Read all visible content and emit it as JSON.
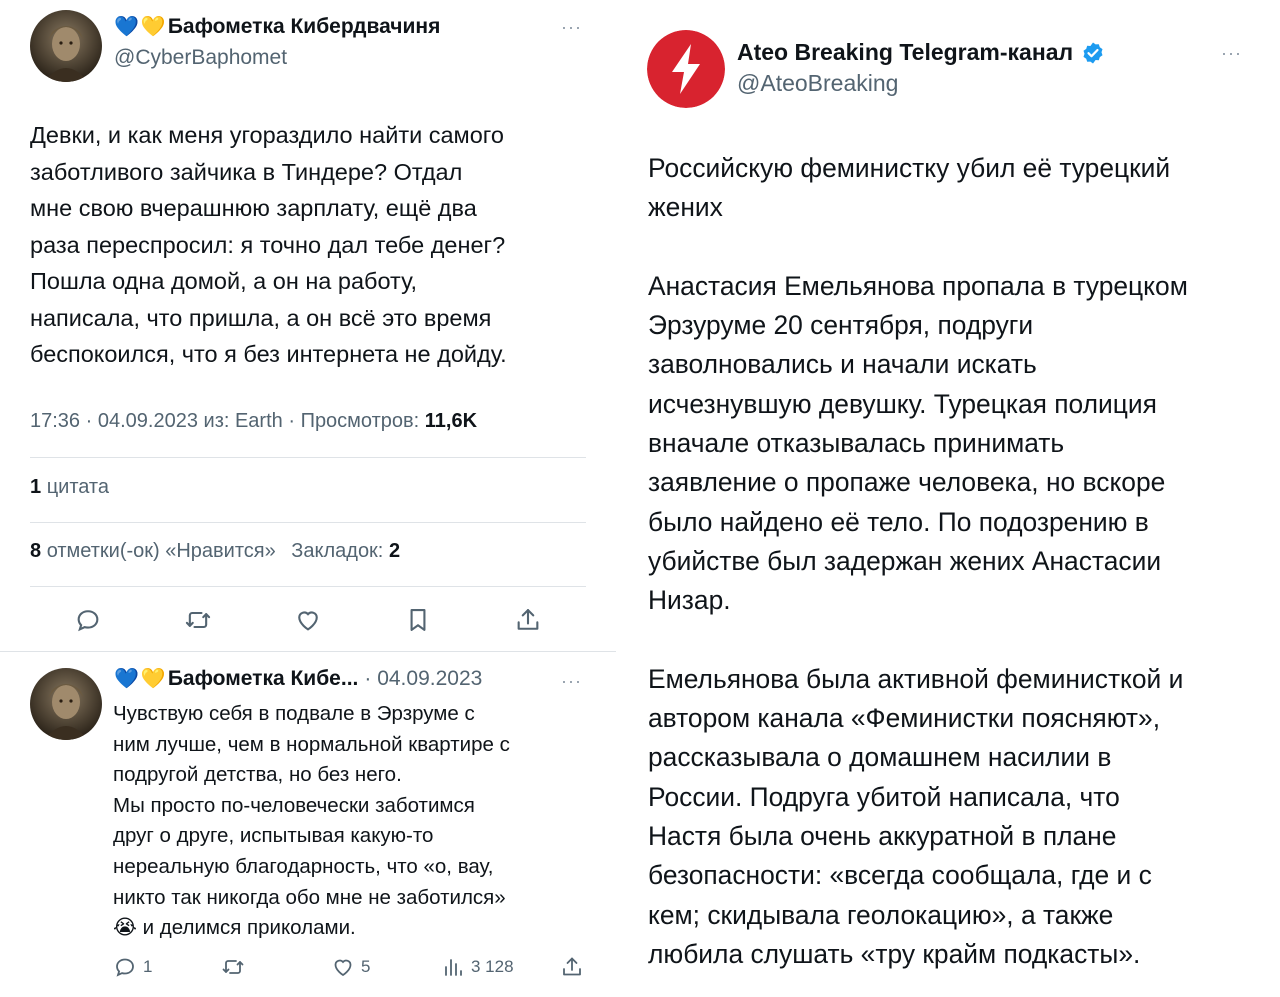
{
  "left_tweet": {
    "author_name": "Бафометка Кибердвачиня",
    "hearts": [
      "💙",
      "💛"
    ],
    "handle": "@CyberBaphomet",
    "more_icon": "more-dots-icon",
    "body": "Девки, и как меня угораздило найти самого\nзаботливого зайчика в Тиндере? Отдал\nмне свою вчерашнюю зарплату, ещё два\nраза переспросил: я точно дал тебе денег?\nПошла одна домой, а он на работу,\nнаписала, что пришла, а он всё это время\nбеспокоился, что я без интернета не дойду.",
    "meta": {
      "time": "17:36",
      "date": "04.09.2023",
      "source": "из: Earth",
      "views_label": "Просмотров:",
      "views_value": "11,6K"
    },
    "quotes": {
      "count": "1",
      "label": "цитата"
    },
    "likes": {
      "count": "8",
      "label": "отметки(-ок) «Нравится»"
    },
    "bookmarks": {
      "label": "Закладок:",
      "count": "2"
    },
    "actions": [
      "reply-icon",
      "retweet-icon",
      "like-icon",
      "bookmark-icon",
      "share-icon"
    ]
  },
  "reply_tweet": {
    "author_name": "Бафометка Кибе...",
    "hearts": [
      "💙",
      "💛"
    ],
    "date": "· 04.09.2023",
    "body": "Чувствую себя в подвале в Эрзруме с\nним лучше, чем в нормальной квартире с\nподругой детства, но без него.\nМы просто по-человечески заботимся\nдруг о друге, испытывая какую-то\nнереальную благодарность, что «о, вау,\nникто так никогда обо мне не заботился»\n😭 и делимся приколами.",
    "stats": {
      "replies": "1",
      "retweets": "",
      "likes": "5",
      "views": "3 128"
    }
  },
  "right_tweet": {
    "author_name": "Ateo Breaking Telegram-канал",
    "handle": "@AteoBreaking",
    "brand_color": "#d8232f",
    "verified_color": "#1d9bf0",
    "paragraphs": [
      "Российскую феминистку убил её турецкий\nжених",
      "Анастасия Емельянова пропала в турецком\nЭрзуруме 20 сентября, подруги\nзаволновались и начали искать\nисчезнувшую девушку. Турецкая полиция\nвначале отказывалась принимать\nзаявление о пропаже человека, но вскоре\nбыло найдено её тело. По подозрению в\nубийстве был задержан жених Анастасии\nНизар.",
      "Емельянова была активной феминисткой и\nавтором канала «Феминистки поясняют»,\nрассказывала о домашнем насилии в\nРоссии. Подруга убитой написала, что\nНастя была очень аккуратной в плане\nбезопасности: «всегда сообщала, где и с\nкем; скидывала геолокацию», а также\nлюбила слушать «тру крайм подкасты»."
    ]
  }
}
